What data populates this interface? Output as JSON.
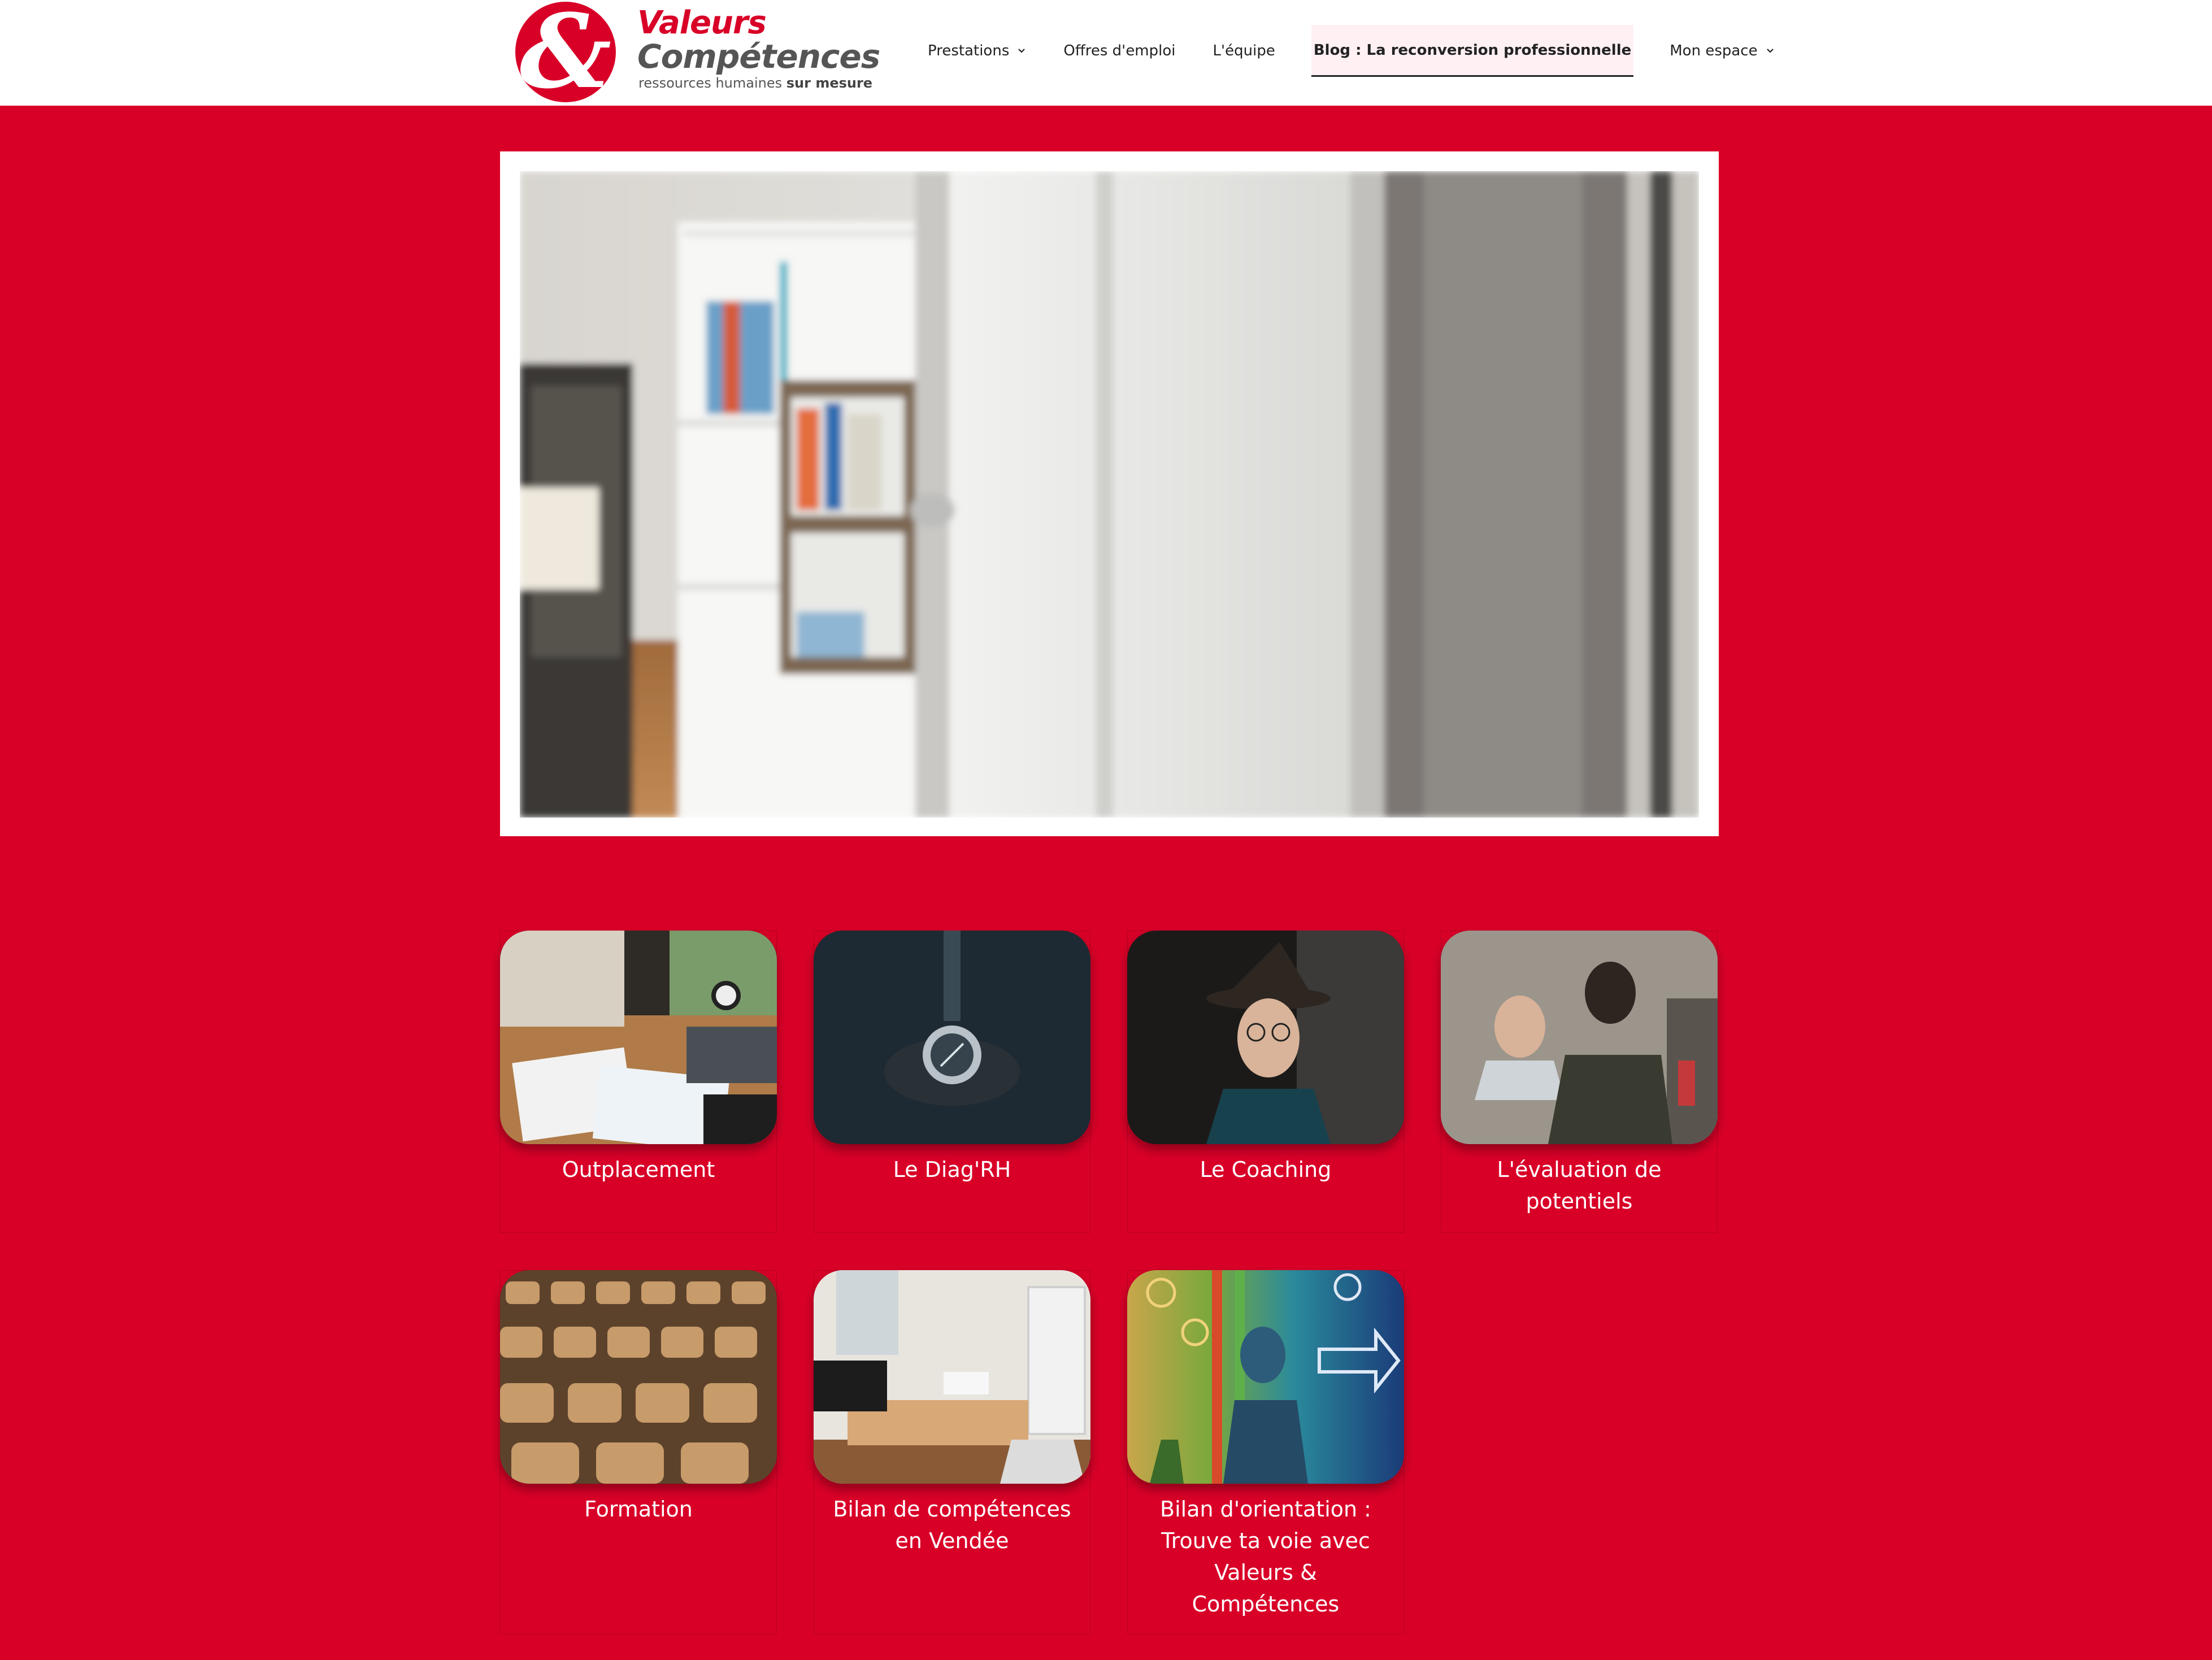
{
  "brand": {
    "mark": "&",
    "name_line1": "Valeurs",
    "name_line2": "Compétences",
    "tagline_prefix": "ressources humaines",
    "tagline_bold": "sur mesure"
  },
  "nav": {
    "items": [
      {
        "label": "Prestations",
        "has_dropdown": true
      },
      {
        "label": "Offres d'emploi",
        "has_dropdown": false
      },
      {
        "label": "L'équipe",
        "has_dropdown": false
      },
      {
        "label": "Blog : La reconversion professionnelle",
        "has_dropdown": false,
        "active": true
      },
      {
        "label": "Mon espace",
        "has_dropdown": true
      }
    ]
  },
  "colors": {
    "brand_red": "#d90028",
    "logo_grey": "#555555",
    "nav_active_bg": "#fff0f3"
  },
  "cards": [
    {
      "title": "Outplacement",
      "image": "interview-desk-photo"
    },
    {
      "title": "Le Diag'RH",
      "image": "compass-in-hand-photo"
    },
    {
      "title": "Le Coaching",
      "image": "wizard-hat-man-photo"
    },
    {
      "title": "L'évaluation de potentiels",
      "image": "two-people-meeting-photo"
    },
    {
      "title": "Formation",
      "image": "lecture-hall-seats-photo"
    },
    {
      "title": "Bilan de compétences en Vendée",
      "image": "office-room-photo"
    },
    {
      "title": "Bilan d'orientation : Trouve ta voie avec Valeurs & Compétences",
      "image": "orientation-illustration"
    }
  ]
}
